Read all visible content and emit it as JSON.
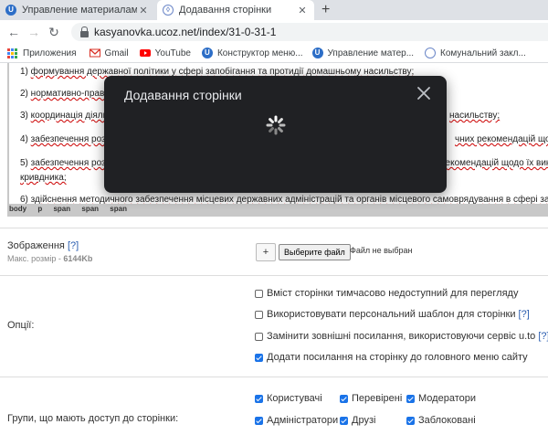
{
  "browser": {
    "tabs": [
      {
        "title": "Управление материалами - Ре...",
        "favicon": "U"
      },
      {
        "title": "Додавання сторінки",
        "favicon": "shield"
      }
    ],
    "new_tab": "+",
    "url": "kasyanovka.ucoz.net/index/31-0-31-1",
    "bookmarks": [
      {
        "label": "Приложения",
        "icon": "apps-icon"
      },
      {
        "label": "Gmail",
        "icon": "gmail-icon"
      },
      {
        "label": "YouTube",
        "icon": "youtube-icon"
      },
      {
        "label": "Конструктор меню...",
        "icon": "ucoz-icon"
      },
      {
        "label": "Управление матер...",
        "icon": "ucoz-icon"
      },
      {
        "label": "Комунальний закл...",
        "icon": "shield-icon"
      }
    ]
  },
  "editor": {
    "lines": [
      {
        "prefix": "1) ",
        "text": "формування державної політики у сфері запобігання та протидії домашньому насильству;"
      },
      {
        "prefix": "2) ",
        "text": "нормативно-правове"
      },
      {
        "prefix": "3) ",
        "text": "координація діяль",
        "tail": "насильству;"
      },
      {
        "prefix": "4) ",
        "text": "забезпечення розро",
        "tail": "чних рекомендацій щодо"
      },
      {
        "prefix": "5) ",
        "text": "забезпечення розро",
        "tail": "рекомендацій щодо їх вико"
      },
      {
        "prefix": "",
        "text": "кривдника;"
      },
      {
        "prefix": "6) ",
        "text": "здійснення методичного забезпечення місцевих державних адміністрацій та органів місцевого самоврядування в сфері запобі"
      }
    ],
    "path": [
      "body",
      "p",
      "span",
      "span",
      "span"
    ]
  },
  "image_field": {
    "label": "Зображення",
    "help": "[?]",
    "max_label": "Макс. розмір - ",
    "max_value": "6144Kb",
    "plus": "+",
    "choose_button": "Выберите файл",
    "file_status": "Файл не выбран"
  },
  "options": {
    "label": "Опції:",
    "items": [
      {
        "text": "Вміст сторінки тимчасово недоступний для перегляду",
        "checked": false
      },
      {
        "text": "Використовувати персональний шаблон для сторінки",
        "help": "[?]",
        "checked": false
      },
      {
        "text": "Замінити зовнішні посилання, використовуючи сервіс u.to",
        "help": "[?]",
        "checked": false
      },
      {
        "text": "Додати посилання на сторінку до головного меню сайту",
        "checked": true
      }
    ]
  },
  "groups": {
    "label": "Групи, що мають доступ до сторінки:",
    "items": [
      {
        "text": "Користувачі",
        "checked": true
      },
      {
        "text": "Перевірені",
        "checked": true
      },
      {
        "text": "Модератори",
        "checked": true
      },
      {
        "text": "Адміністратори",
        "checked": true
      },
      {
        "text": "Друзі",
        "checked": true
      },
      {
        "text": "Заблоковані",
        "checked": true
      }
    ]
  },
  "modal": {
    "title": "Додавання сторінки",
    "close_icon": "close-icon",
    "spinner_icon": "loading-spinner-icon"
  },
  "colors": {
    "modal_bg": "#202124",
    "checkbox_accent": "#1a73e8",
    "link": "#2a5db0"
  }
}
